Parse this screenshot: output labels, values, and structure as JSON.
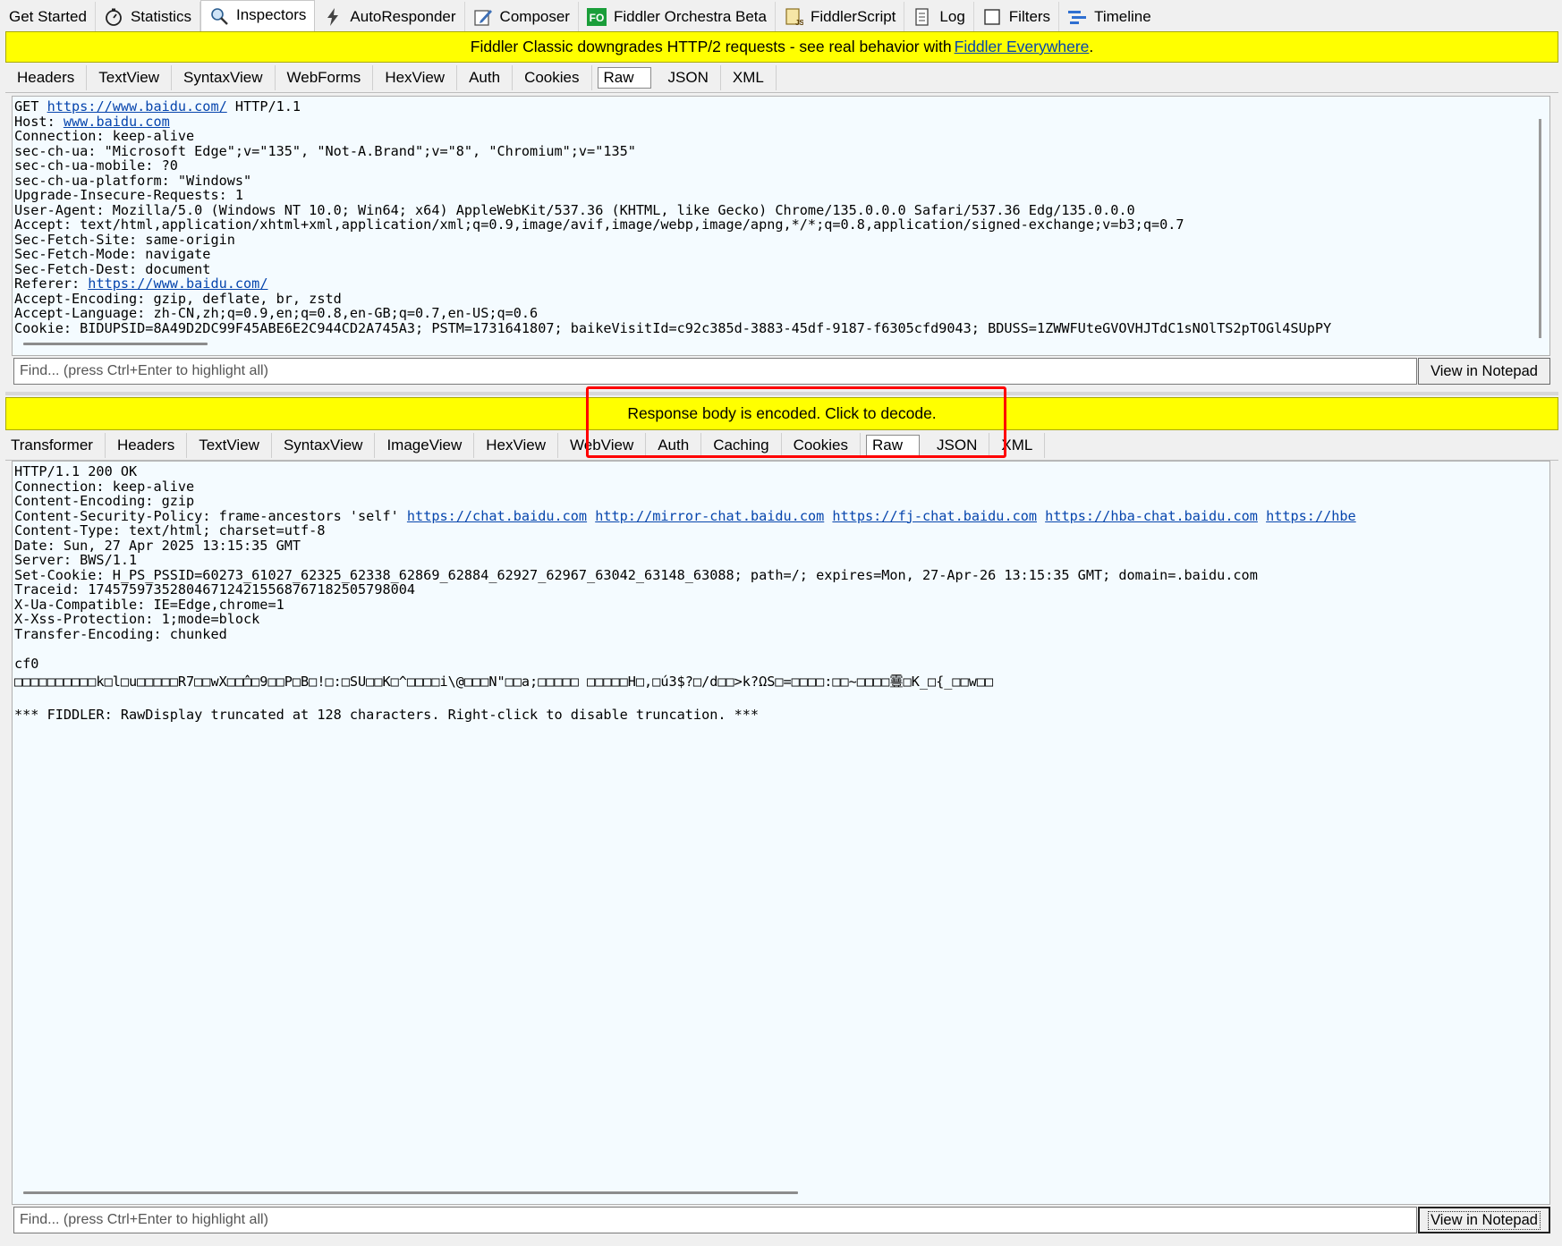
{
  "top_tabs": [
    {
      "label": "Get Started",
      "icon": "none"
    },
    {
      "label": "Statistics",
      "icon": "stopwatch-icon"
    },
    {
      "label": "Inspectors",
      "icon": "magnifier-icon",
      "active": true
    },
    {
      "label": "AutoResponder",
      "icon": "lightning-icon"
    },
    {
      "label": "Composer",
      "icon": "pencil-icon"
    },
    {
      "label": "Fiddler Orchestra Beta",
      "icon": "fo-icon"
    },
    {
      "label": "FiddlerScript",
      "icon": "script-icon"
    },
    {
      "label": "Log",
      "icon": "log-icon"
    },
    {
      "label": "Filters",
      "icon": "checkbox-icon"
    },
    {
      "label": "Timeline",
      "icon": "timeline-icon"
    }
  ],
  "banner_top": {
    "text": "Fiddler Classic downgrades HTTP/2 requests - see real behavior with",
    "link": "Fiddler Everywhere",
    "suffix": "."
  },
  "request": {
    "tabs": [
      "Headers",
      "TextView",
      "SyntaxView",
      "WebForms",
      "HexView",
      "Auth",
      "Cookies",
      "Raw",
      "JSON",
      "XML"
    ],
    "active_tab": "Raw",
    "raw": {
      "line1_method": "GET ",
      "line1_url": "https://www.baidu.com/",
      "line1_proto": " HTTP/1.1",
      "host_label": "Host: ",
      "host_value": "www.baidu.com",
      "lines_a": [
        "Connection: keep-alive",
        "sec-ch-ua: \"Microsoft Edge\";v=\"135\", \"Not-A.Brand\";v=\"8\", \"Chromium\";v=\"135\"",
        "sec-ch-ua-mobile: ?0",
        "sec-ch-ua-platform: \"Windows\"",
        "Upgrade-Insecure-Requests: 1",
        "User-Agent: Mozilla/5.0 (Windows NT 10.0; Win64; x64) AppleWebKit/537.36 (KHTML, like Gecko) Chrome/135.0.0.0 Safari/537.36 Edg/135.0.0.0",
        "Accept: text/html,application/xhtml+xml,application/xml;q=0.9,image/avif,image/webp,image/apng,*/*;q=0.8,application/signed-exchange;v=b3;q=0.7",
        "Sec-Fetch-Site: same-origin",
        "Sec-Fetch-Mode: navigate",
        "Sec-Fetch-Dest: document"
      ],
      "referer_label": "Referer: ",
      "referer_value": "https://www.baidu.com/",
      "lines_b": [
        "Accept-Encoding: gzip, deflate, br, zstd",
        "Accept-Language: zh-CN,zh;q=0.9,en;q=0.8,en-GB;q=0.7,en-US;q=0.6",
        "Cookie: BIDUPSID=8A49D2DC99F45ABE6E2C944CD2A745A3; PSTM=1731641807; baikeVisitId=c92c385d-3883-45df-9187-f6305cfd9043; BDUSS=1ZWWFUteGVOVHJTdC1sNOlTS2pTOGl4SUpPY"
      ]
    },
    "find_placeholder": "Find... (press Ctrl+Enter to highlight all)",
    "notepad_label": "View in Notepad"
  },
  "banner_resp": {
    "text": "Response body is encoded. Click to decode."
  },
  "response": {
    "tabs": [
      "Transformer",
      "Headers",
      "TextView",
      "SyntaxView",
      "ImageView",
      "HexView",
      "WebView",
      "Auth",
      "Caching",
      "Cookies",
      "Raw",
      "JSON",
      "XML"
    ],
    "active_tab": "Raw",
    "raw": {
      "lines_a": [
        "HTTP/1.1 200 OK",
        "Connection: keep-alive",
        "Content-Encoding: gzip"
      ],
      "csp_label": "Content-Security-Policy: frame-ancestors 'self' ",
      "csp_links": [
        "https://chat.baidu.com",
        "http://mirror-chat.baidu.com",
        "https://fj-chat.baidu.com",
        "https://hba-chat.baidu.com",
        "https://hbe"
      ],
      "lines_b": [
        "Content-Type: text/html; charset=utf-8",
        "Date: Sun, 27 Apr 2025 13:15:35 GMT",
        "Server: BWS/1.1",
        "Set-Cookie: H_PS_PSSID=60273_61027_62325_62338_62869_62884_62927_62967_63042_63148_63088; path=/; expires=Mon, 27-Apr-26 13:15:35 GMT; domain=.baidu.com",
        "Traceid: 1745759735280467124215568767182505798004",
        "X-Ua-Compatible: IE=Edge,chrome=1",
        "X-Xss-Protection: 1;mode=block",
        "Transfer-Encoding: chunked",
        "",
        "cf0"
      ],
      "binary_line": "□□□□□□□□□□k□l□u□□□□□R7□□wX□□̂̂□□9□□P□B□!□:□SU□□K□^□□□□i\\@□□□N\"□□a;□□□□□ □□□□□H□,□ú3$?□/d□□>k?ΩS□=□□□□:□□~□□□□靊□K_□{_□□w□□",
      "truncation_note": "*** FIDDLER: RawDisplay truncated at 128 characters. Right-click to disable truncation. ***"
    },
    "find_placeholder": "Find... (press Ctrl+Enter to highlight all)",
    "notepad_label": "View in Notepad"
  },
  "colors": {
    "banner_yellow": "#ffff00",
    "highlight_red": "#ff0000",
    "link_blue": "#0645ad",
    "pane_bg": "#f4fbff"
  }
}
